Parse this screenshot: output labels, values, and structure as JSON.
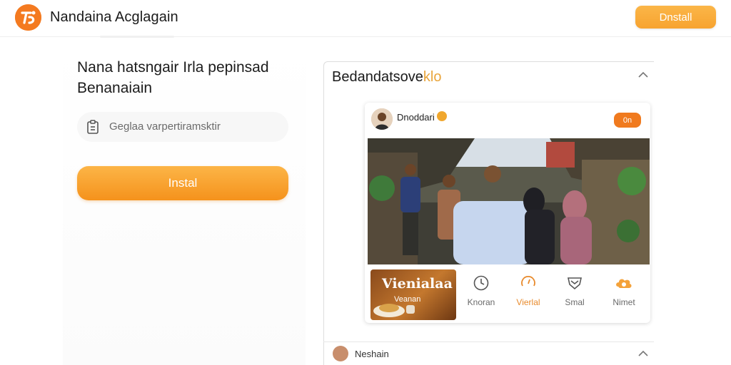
{
  "header": {
    "app_title": "Nandaina Acglagain",
    "install_label": "Dnstall"
  },
  "left": {
    "headline_line1": "Nana hatsngair Irla pepinsad",
    "headline_line2": "Benanaiain",
    "search_placeholder": "Geglaa varpertiramsktir",
    "install_label": "Instal"
  },
  "panel": {
    "title_main": "Bedandatsove",
    "title_highlight": "klo"
  },
  "post": {
    "author": "Dnoddari",
    "badge": "0n"
  },
  "food_tile": {
    "title": "Vienialaa",
    "subtitle": "Veanan"
  },
  "nav": [
    {
      "label": "Knoran",
      "icon": "clock-icon"
    },
    {
      "label": "Vierlal",
      "icon": "dial-icon"
    },
    {
      "label": "Smal",
      "icon": "shield-icon"
    },
    {
      "label": "Nimet",
      "icon": "cloud-icon"
    }
  ],
  "row2": {
    "name": "Neshain"
  },
  "colors": {
    "accent": "#f5a030",
    "brand": "#f47a20",
    "active_nav": "#e88a2c"
  }
}
